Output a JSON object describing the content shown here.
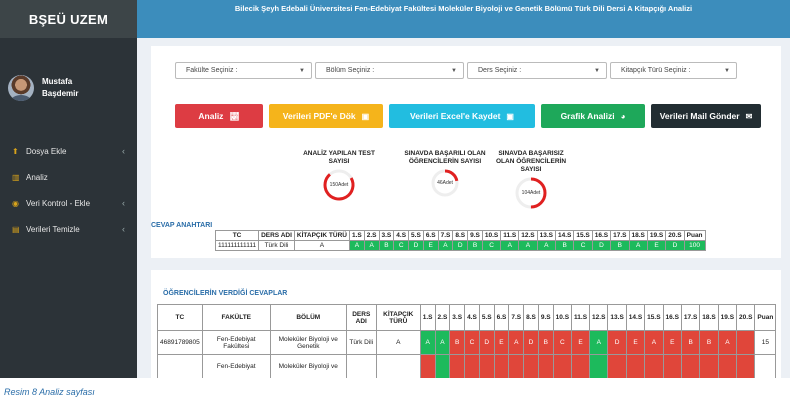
{
  "app": {
    "brand": "BŞEÜ UZEM",
    "title": "Bilecik Şeyh Edebali Üniversitesi Fen-Edebiyat Fakültesi Moleküler Biyoloji ve Genetik Bölümü Türk Dili Dersi A Kitapçığı Analizi"
  },
  "user": {
    "first": "Mustafa",
    "last": "Başdemir"
  },
  "menu": [
    {
      "label": "Dosya Ekle",
      "icon": "upload-icon",
      "chevron": true
    },
    {
      "label": "Analiz",
      "icon": "bar-chart-icon",
      "chevron": false
    },
    {
      "label": "Veri Kontrol - Ekle",
      "icon": "eye-icon",
      "chevron": true
    },
    {
      "label": "Verileri Temizle",
      "icon": "trash-icon",
      "chevron": true
    }
  ],
  "filters": [
    "Fakülte Seçiniz :",
    "Bölüm Seçiniz :",
    "Ders Seçiniz :",
    "Kitapçık Türü Seçiniz :"
  ],
  "buttons": [
    {
      "label": "Analiz",
      "icon": "line-chart-icon",
      "color": "#dd3c43"
    },
    {
      "label": "Verileri PDF'e Dök",
      "icon": "pdf-icon",
      "color": "#f5b41b"
    },
    {
      "label": "Verileri Excel'e Kaydet",
      "icon": "excel-icon",
      "color": "#22bde0"
    },
    {
      "label": "Grafik Analizi",
      "icon": "pie-chart-icon",
      "color": "#1ea85a"
    },
    {
      "label": "Verileri Mail Gönder",
      "icon": "mail-icon",
      "color": "#222d32"
    }
  ],
  "stats": [
    {
      "label": "ANALİZ YAPILAN TEST SAYISI",
      "value_text": "150Adet",
      "fraction": 0.72
    },
    {
      "label": "SINAVDA BAŞARILI OLAN ÖĞRENCİLERİN SAYISI",
      "value_text": "46Adet",
      "fraction": 0.22
    },
    {
      "label": "SINAVDA BAŞARISIZ OLAN ÖĞRENCİLERİN SAYISI",
      "value_text": "104Adet",
      "fraction": 0.5
    }
  ],
  "cevap_anahtari": {
    "title": "CEVAP ANAHTARI",
    "headers": [
      "TC",
      "DERS ADI",
      "KİTAPÇIK TÜRÜ",
      "1.S",
      "2.S",
      "3.S",
      "4.S",
      "5.S",
      "6.S",
      "7.S",
      "8.S",
      "9.S",
      "10.S",
      "11.S",
      "12.S",
      "13.S",
      "14.S",
      "15.S",
      "16.S",
      "17.S",
      "18.S",
      "19.S",
      "20.S",
      "Puan"
    ],
    "row": {
      "tc": "111111111111",
      "ders": "Türk Dili",
      "kitapcik": "A",
      "answers": [
        "A",
        "A",
        "B",
        "C",
        "D",
        "E",
        "A",
        "D",
        "B",
        "C",
        "A",
        "A",
        "A",
        "B",
        "C",
        "D",
        "B",
        "A",
        "E",
        "D"
      ],
      "puan": "100"
    }
  },
  "ogrenci": {
    "title": "ÖĞRENCİLERİN VERDİĞİ CEVAPLAR",
    "headers": [
      "TC",
      "FAKÜLTE",
      "BÖLÜM",
      "DERS ADI",
      "KİTAPÇIK TÜRÜ",
      "1.S",
      "2.S",
      "3.S",
      "4.S",
      "5.S",
      "6.S",
      "7.S",
      "8.S",
      "9.S",
      "10.S",
      "11.S",
      "12.S",
      "13.S",
      "14.S",
      "15.S",
      "16.S",
      "17.S",
      "18.S",
      "19.S",
      "20.S",
      "Puan"
    ],
    "rows": [
      {
        "tc": "46891789805",
        "fakulte": "Fen-Edebiyat Fakültesi",
        "bolum": "Moleküler Biyoloji ve Genetik",
        "ders": "Türk Dili",
        "kitapcik": "A",
        "answers": [
          "A",
          "A",
          "B",
          "C",
          "D",
          "E",
          "A",
          "D",
          "B",
          "C",
          "E",
          "A",
          "D",
          "E",
          "A",
          "E",
          "B",
          "B",
          "A",
          ""
        ],
        "correct": [
          true,
          true,
          false,
          false,
          false,
          false,
          false,
          false,
          false,
          false,
          false,
          true,
          false,
          false,
          false,
          false,
          false,
          false,
          false,
          false
        ],
        "puan": "15"
      },
      {
        "tc": "",
        "fakulte": "Fen-Edebiyat",
        "bolum": "Moleküler Biyoloji ve",
        "ders": "",
        "kitapcik": "",
        "answers": [
          "",
          "",
          "",
          "",
          "",
          "",
          "",
          "",
          "",
          "",
          "",
          "",
          "",
          "",
          "",
          "",
          "",
          "",
          "",
          ""
        ],
        "correct": [
          false,
          true,
          false,
          false,
          false,
          false,
          false,
          false,
          false,
          false,
          false,
          true,
          false,
          false,
          false,
          false,
          false,
          false,
          false,
          false
        ],
        "puan": ""
      }
    ]
  },
  "caption": "Resim 8 Analiz sayfası"
}
